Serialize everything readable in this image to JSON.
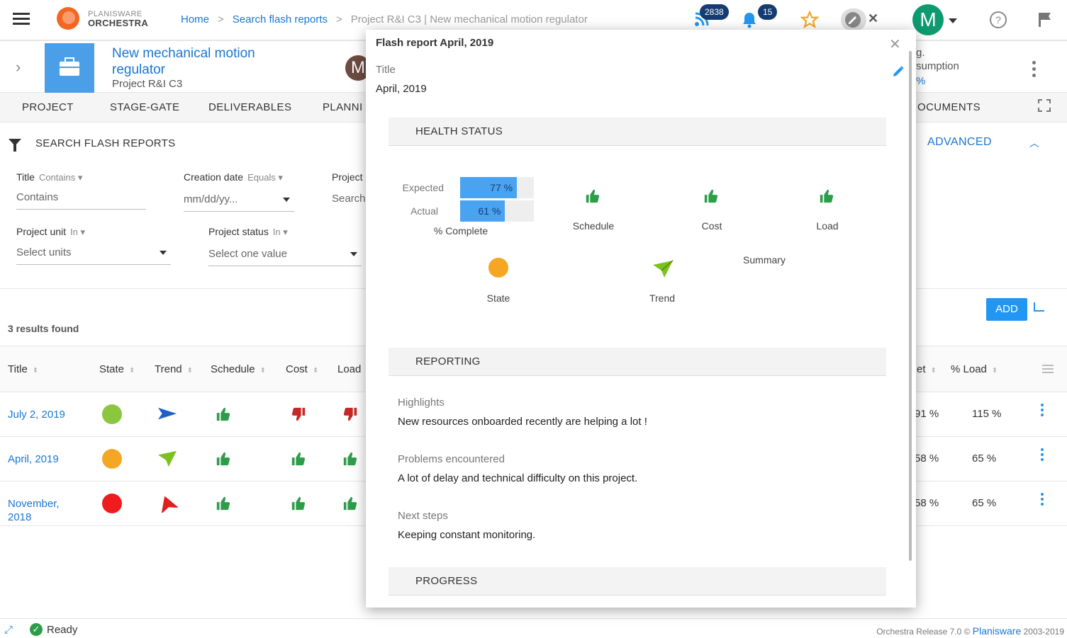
{
  "brand": {
    "line1": "PLANISWARE",
    "line2": "ORCHESTRA"
  },
  "breadcrumb": {
    "home": "Home",
    "sep": ">",
    "search": "Search flash reports",
    "current": "Project R&I C3 | New mechanical motion regulator"
  },
  "topbar": {
    "feed_count": "2838",
    "notif_count": "15",
    "user_initial": "M"
  },
  "project": {
    "title": "New mechanical motion regulator",
    "subtitle": "Project R&I C3",
    "owner_initial": "M",
    "kpi_line1": "g.",
    "kpi_line2": "sumption",
    "kpi_line3": "%"
  },
  "tabs": [
    "PROJECT",
    "STAGE-GATE",
    "DELIVERABLES",
    "PLANNI",
    "OCUMENTS"
  ],
  "search": {
    "heading": "SEARCH FLASH REPORTS",
    "advanced": "ADVANCED",
    "filters": {
      "title": {
        "label": "Title",
        "op": "Contains",
        "placeholder": "Contains"
      },
      "creation_date": {
        "label": "Creation date",
        "op": "Equals",
        "placeholder": "mm/dd/yy..."
      },
      "project": {
        "label": "Project",
        "placeholder": "Search"
      },
      "project_unit": {
        "label": "Project unit",
        "op": "In",
        "placeholder": "Select units"
      },
      "project_status": {
        "label": "Project status",
        "op": "In",
        "placeholder": "Select one value"
      }
    }
  },
  "results": {
    "count_text": "3 results found",
    "add_label": "ADD"
  },
  "table": {
    "columns": [
      "Title",
      "State",
      "Trend",
      "Schedule",
      "Cost",
      "Load",
      "et",
      "% Load"
    ],
    "rows": [
      {
        "title": "July 2, 2019",
        "state": "#8bc63f",
        "trend": "blue-right",
        "schedule": "up",
        "cost": "down",
        "load": "down",
        "pct_cost": "91 %",
        "pct_load": "115 %"
      },
      {
        "title": "April, 2019",
        "state": "#f5a623",
        "trend": "green-diag",
        "schedule": "up",
        "cost": "up",
        "load": "up",
        "pct_cost": "58 %",
        "pct_load": "65 %"
      },
      {
        "title": "November, 2018",
        "state": "#ee1c1c",
        "trend": "red-up",
        "schedule": "up",
        "cost": "up",
        "load": "up",
        "pct_cost": "58 %",
        "pct_load": "65 %"
      }
    ]
  },
  "status": {
    "ready": "Ready",
    "copyright_prefix": "Orchestra Release 7.0 ©",
    "company": "Planisware",
    "years": "2003-2019"
  },
  "modal": {
    "title": "Flash report April, 2019",
    "field_title_label": "Title",
    "field_title_value": "April, 2019",
    "health_section": "HEALTH STATUS",
    "expected_label": "Expected",
    "expected_text": "77 %",
    "expected_pct": 77,
    "actual_label": "Actual",
    "actual_text": "61 %",
    "actual_pct": 61,
    "complete_caption": "% Complete",
    "schedule_caption": "Schedule",
    "cost_caption": "Cost",
    "load_caption": "Load",
    "summary_caption": "Summary",
    "state_caption": "State",
    "trend_caption": "Trend",
    "reporting_section": "REPORTING",
    "highlights_label": "Highlights",
    "highlights_value": "New resources onboarded recently are helping a lot !",
    "problems_label": "Problems encountered",
    "problems_value": "A lot of delay and technical difficulty on this project.",
    "next_label": "Next steps",
    "next_value": "Keeping constant monitoring.",
    "progress_section": "PROGRESS"
  },
  "colors": {
    "accent": "#1976d2",
    "thumb_up": "#2e9d4a",
    "thumb_down": "#c62828",
    "state_orange": "#f5a623"
  }
}
